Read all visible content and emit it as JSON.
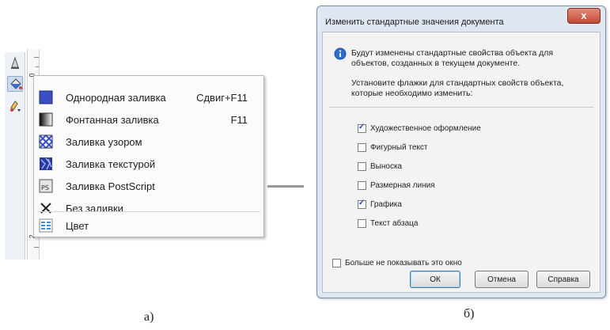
{
  "panel_a": {
    "ruler_numbers": [
      "0",
      "2"
    ],
    "fill_menu": [
      {
        "label": "Однородная заливка",
        "shortcut": "Сдвиг+F11",
        "icon": "uniform-fill-icon"
      },
      {
        "label": "Фонтанная заливка",
        "shortcut": "F11",
        "icon": "fountain-fill-icon"
      },
      {
        "label": "Заливка узором",
        "shortcut": "",
        "icon": "pattern-fill-icon"
      },
      {
        "label": "Заливка текстурой",
        "shortcut": "",
        "icon": "texture-fill-icon"
      },
      {
        "label": "Заливка PostScript",
        "shortcut": "",
        "icon": "postscript-fill-icon"
      },
      {
        "label": "Без заливки",
        "shortcut": "",
        "icon": "no-fill-icon"
      },
      {
        "label": "Цвет",
        "shortcut": "",
        "icon": "color-icon"
      }
    ],
    "caption": "а)"
  },
  "panel_b": {
    "title": "Изменить стандартные значения документа",
    "close_label": "x",
    "info_line1": "Будут изменены стандартные свойства объекта для объектов, созданных в текущем документе.",
    "info_line2": "Установите флажки для стандартных свойств объекта, которые необходимо изменить:",
    "checkboxes": [
      {
        "label": "Художественное оформление",
        "checked": true
      },
      {
        "label": "Фигурный текст",
        "checked": false
      },
      {
        "label": "Выноска",
        "checked": false
      },
      {
        "label": "Размерная линия",
        "checked": false
      },
      {
        "label": "Графика",
        "checked": true
      },
      {
        "label": "Текст абзаца",
        "checked": false
      }
    ],
    "dont_show": {
      "label": "Больше не показывать это окно",
      "checked": false
    },
    "buttons": {
      "ok": "ОК",
      "cancel": "Отмена",
      "help": "Справка"
    },
    "caption": "б)"
  },
  "colors": {
    "accent_blue": "#3b4fc4",
    "dialog_frame": "#dfe7f1",
    "close_red": "#c24a34"
  }
}
